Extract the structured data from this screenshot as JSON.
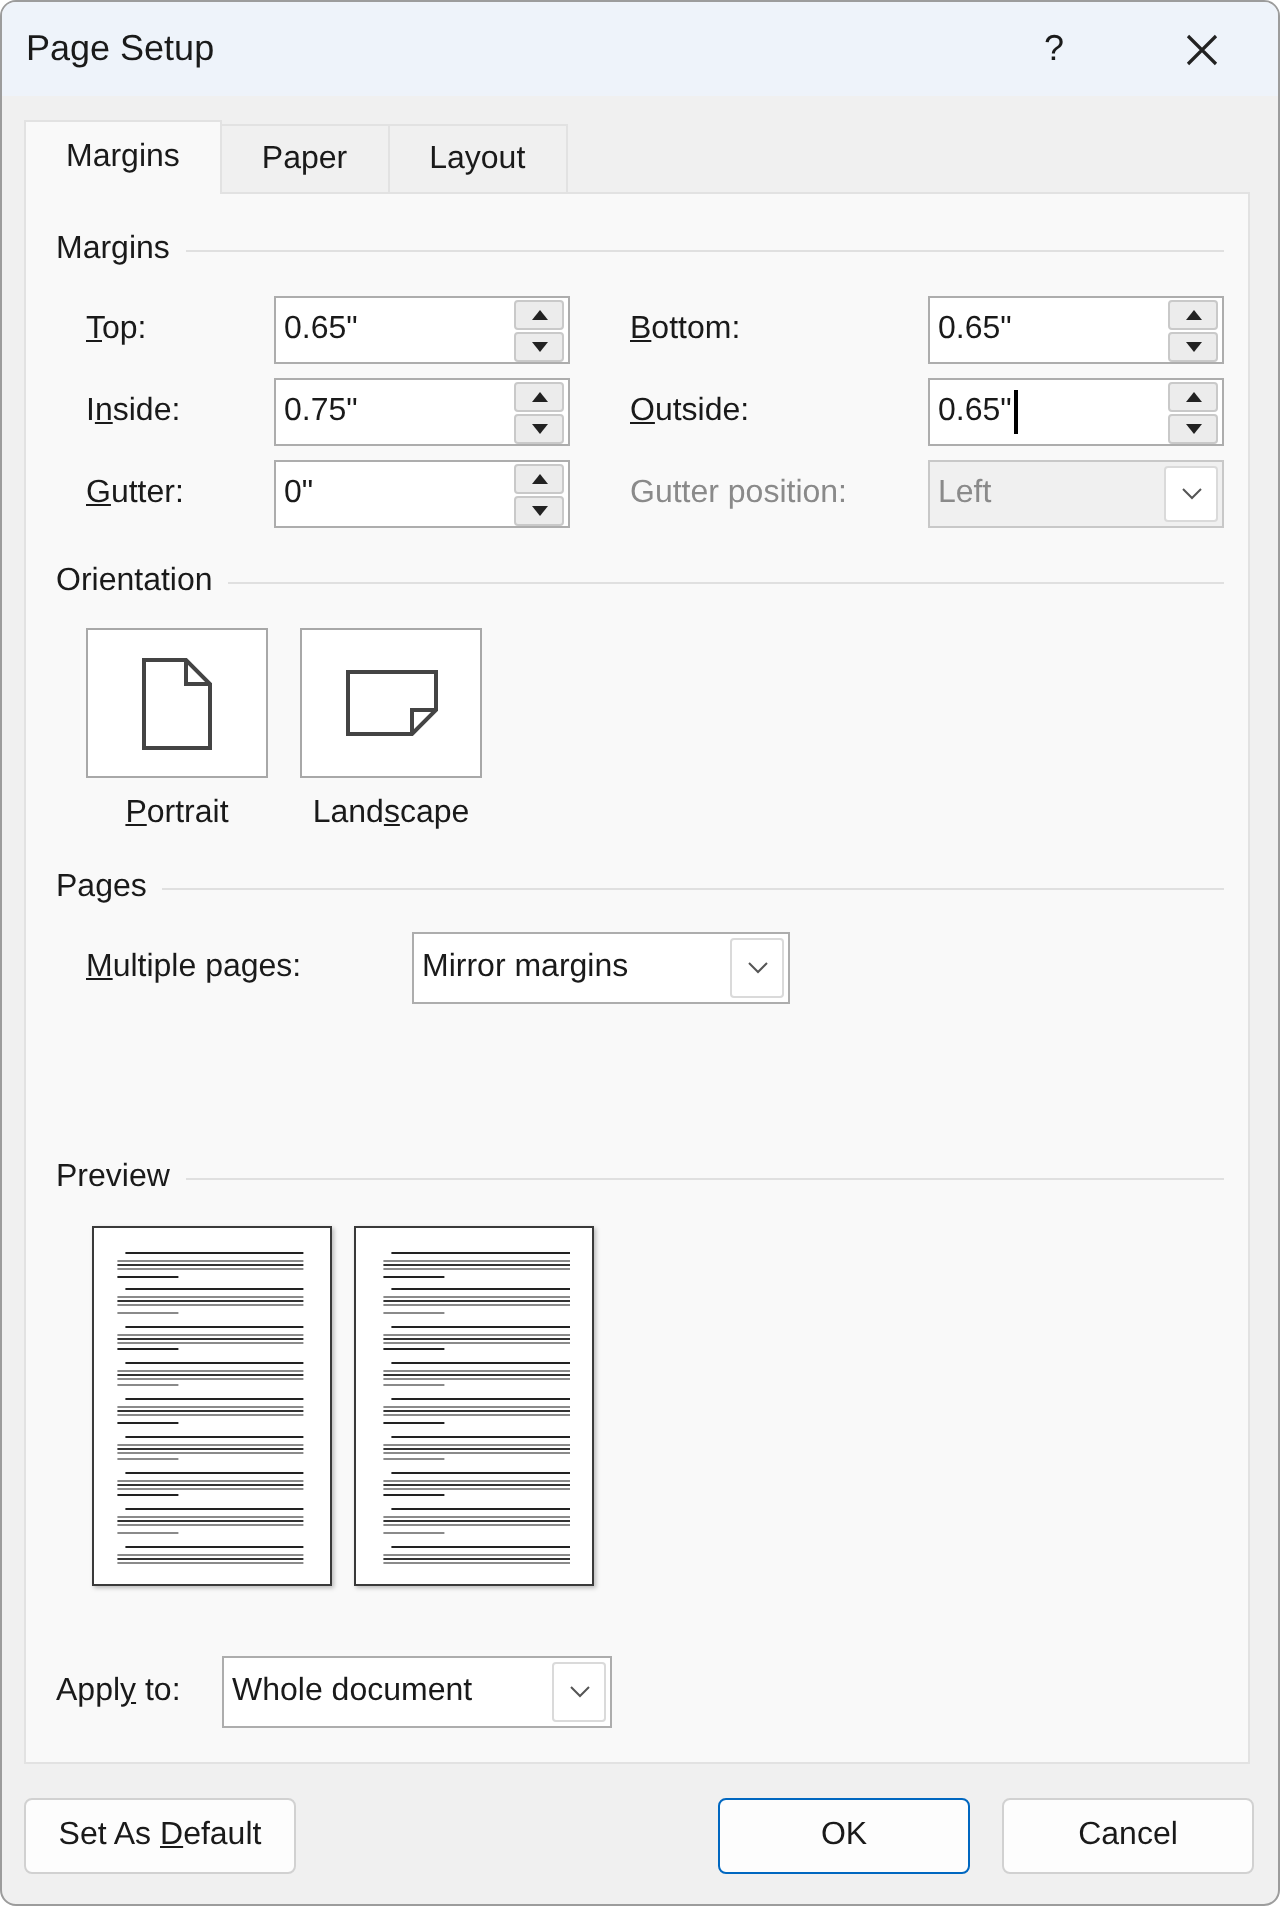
{
  "window": {
    "title": "Page Setup",
    "help": "?"
  },
  "tabs": [
    {
      "label": "Margins",
      "selected": true
    },
    {
      "label": "Paper",
      "selected": false
    },
    {
      "label": "Layout",
      "selected": false
    }
  ],
  "margins": {
    "heading": "Margins",
    "fields": [
      {
        "label": {
          "key": "T",
          "after": "op:"
        },
        "kind": "spin",
        "value": "0.65\"",
        "disabled": false,
        "focused": false
      },
      {
        "label": {
          "key": "B",
          "after": "ottom:"
        },
        "kind": "spin",
        "value": "0.65\"",
        "disabled": false,
        "focused": false
      },
      {
        "label": {
          "before": "I",
          "key": "n",
          "after": "side:"
        },
        "kind": "spin",
        "value": "0.75\"",
        "disabled": false,
        "focused": false
      },
      {
        "label": {
          "key": "O",
          "after": "utside:"
        },
        "kind": "spin",
        "value": "0.65\"",
        "disabled": false,
        "focused": true
      },
      {
        "label": {
          "key": "G",
          "after": "utter:"
        },
        "kind": "spin",
        "value": "0\"",
        "disabled": false,
        "focused": false
      },
      {
        "label": {
          "before": "Gutter position:"
        },
        "kind": "dropdown",
        "value": "Left",
        "disabled": true,
        "focused": false
      }
    ]
  },
  "orientation": {
    "heading": "Orientation",
    "options": [
      {
        "kind": "portrait",
        "label": {
          "key": "P",
          "after": "ortrait"
        }
      },
      {
        "kind": "landscape",
        "label": {
          "before": "Land",
          "key": "s",
          "after": "cape"
        }
      }
    ]
  },
  "pages": {
    "heading": "Pages",
    "multiple_pages": {
      "label": {
        "key": "M",
        "after": "ultiple pages:"
      },
      "value": "Mirror margins"
    }
  },
  "preview": {
    "heading": "Preview"
  },
  "apply_to": {
    "label": {
      "before": "Appl",
      "key": "y",
      "after": " to:"
    },
    "value": "Whole document"
  },
  "buttons": [
    {
      "label": {
        "before": "Set As ",
        "key": "D",
        "after": "efault"
      },
      "kind": "secondary"
    },
    {
      "label": {
        "before": "OK"
      },
      "kind": "default"
    },
    {
      "label": {
        "before": "Cancel"
      },
      "kind": "secondary"
    }
  ]
}
